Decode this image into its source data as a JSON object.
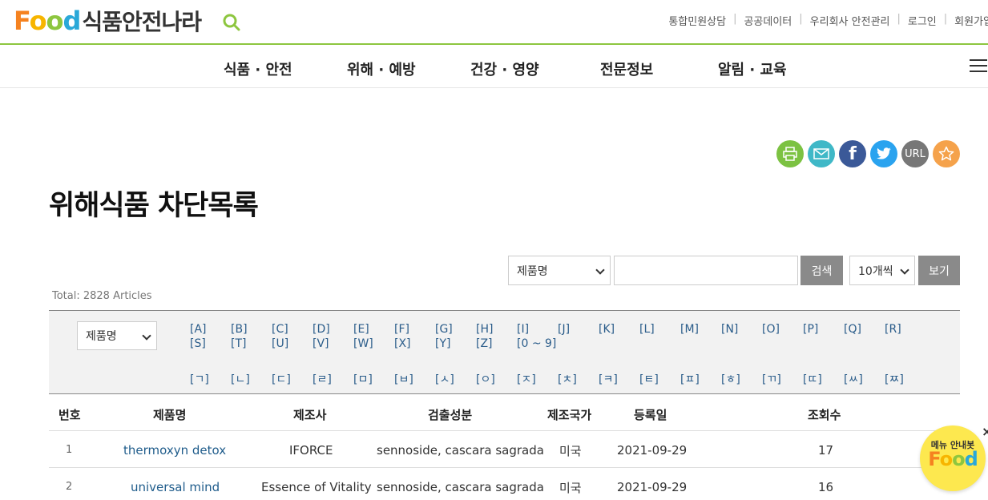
{
  "header": {
    "logo_food": "Food",
    "logo_site_name": "식품안전나라",
    "util_links": [
      "통합민원상담",
      "공공데이터",
      "우리회사 안전관리",
      "로그인",
      "회원가입"
    ]
  },
  "gnb": {
    "menu": [
      "식품 · 안전",
      "위해 · 예방",
      "건강 · 영양",
      "전문정보",
      "알림 · 교육"
    ]
  },
  "sns": {
    "url_label": "URL",
    "colors": {
      "print": "#7cc242",
      "mail": "#3fb8c7",
      "facebook": "#3b5998",
      "twitter": "#2aa3ef",
      "url": "#777777",
      "favorite": "#f5a24b"
    }
  },
  "page_title": "위해식품 차단목록",
  "search": {
    "field_select": "제품명",
    "input_value": "",
    "search_button": "검색",
    "page_size_select": "10개씩",
    "view_button": "보기"
  },
  "total_text": "Total: 2828 Articles",
  "index_panel": {
    "field_select": "제품명",
    "alpha_row1": [
      "[A]",
      "[B]",
      "[C]",
      "[D]",
      "[E]",
      "[F]",
      "[G]",
      "[H]",
      "[I]",
      "[J]",
      "[K]",
      "[L]",
      "[M]",
      "[N]",
      "[O]",
      "[P]",
      "[Q]",
      "[R]"
    ],
    "alpha_row2": [
      "[S]",
      "[T]",
      "[U]",
      "[V]",
      "[W]",
      "[X]",
      "[Y]",
      "[Z]",
      "[0 ~ 9]"
    ],
    "hangul_row": [
      "[ㄱ]",
      "[ㄴ]",
      "[ㄷ]",
      "[ㄹ]",
      "[ㅁ]",
      "[ㅂ]",
      "[ㅅ]",
      "[ㅇ]",
      "[ㅈ]",
      "[ㅊ]",
      "[ㅋ]",
      "[ㅌ]",
      "[ㅍ]",
      "[ㅎ]",
      "[ㄲ]",
      "[ㄸ]",
      "[ㅆ]",
      "[ㅉ]"
    ]
  },
  "table": {
    "headers": [
      "번호",
      "제품명",
      "제조사",
      "검출성분",
      "제조국가",
      "등록일",
      "조회수"
    ],
    "rows": [
      [
        "1",
        "thermoxyn detox",
        "IFORCE",
        "sennoside, cascara sagrada",
        "미국",
        "2021-09-29",
        "17"
      ],
      [
        "2",
        "universal mind",
        "Essence of Vitality",
        "sennoside, cascara sagrada",
        "미국",
        "2021-09-29",
        "16"
      ]
    ]
  },
  "chatbot": {
    "label": "메뉴 안내봇",
    "logo": "Food",
    "close": "×"
  }
}
